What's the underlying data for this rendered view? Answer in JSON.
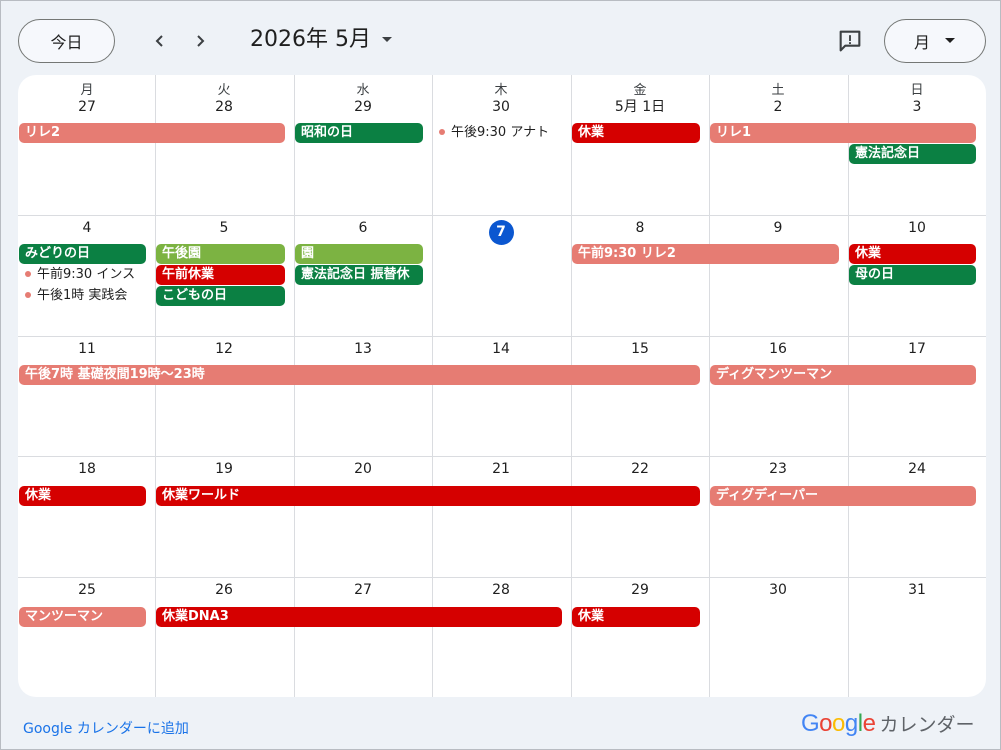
{
  "header": {
    "today_label": "今日",
    "month_title": "2026年 5月",
    "view_label": "月"
  },
  "colors": {
    "salmon": "#e67c73",
    "red": "#d50000",
    "green": "#0b8043",
    "lime": "#7cb342",
    "today": "#0b57d0"
  },
  "weekdays": [
    "月",
    "火",
    "水",
    "木",
    "金",
    "土",
    "日"
  ],
  "weeks": [
    {
      "days": [
        "27",
        "28",
        "29",
        "30",
        "5月 1日",
        "2",
        "3"
      ],
      "events": [
        {
          "title": "リレ2",
          "start": 0,
          "span": 2,
          "lane": 0,
          "color": "salmon"
        },
        {
          "title": "昭和の日",
          "start": 2,
          "span": 1,
          "lane": 0,
          "color": "green"
        },
        {
          "title": "午後9:30 アナト",
          "start": 3,
          "span": 1,
          "lane": 0,
          "type": "timed"
        },
        {
          "title": "休業",
          "start": 4,
          "span": 1,
          "lane": 0,
          "color": "red"
        },
        {
          "title": "リレ1",
          "start": 5,
          "span": 2,
          "lane": 0,
          "color": "salmon"
        },
        {
          "title": "憲法記念日",
          "start": 6,
          "span": 1,
          "lane": 1,
          "color": "green"
        }
      ]
    },
    {
      "days": [
        "4",
        "5",
        "6",
        "7",
        "8",
        "9",
        "10"
      ],
      "today_index": 3,
      "events": [
        {
          "title": "みどりの日",
          "start": 0,
          "span": 1,
          "lane": 0,
          "color": "green"
        },
        {
          "title": "午前9:30 インス",
          "start": 0,
          "span": 1,
          "lane": 1,
          "type": "timed"
        },
        {
          "title": "午後1時 実践会",
          "start": 0,
          "span": 1,
          "lane": 2,
          "type": "timed"
        },
        {
          "title": "午後園",
          "start": 1,
          "span": 1,
          "lane": 0,
          "color": "lime"
        },
        {
          "title": "午前休業",
          "start": 1,
          "span": 1,
          "lane": 1,
          "color": "red"
        },
        {
          "title": "こどもの日",
          "start": 1,
          "span": 1,
          "lane": 2,
          "color": "green"
        },
        {
          "title": "園",
          "start": 2,
          "span": 1,
          "lane": 0,
          "color": "lime"
        },
        {
          "title": "憲法記念日 振替休",
          "start": 2,
          "span": 1,
          "lane": 1,
          "color": "green"
        },
        {
          "title": "午前9:30 リレ2",
          "start": 4,
          "span": 2,
          "lane": 0,
          "color": "salmon"
        },
        {
          "title": "休業",
          "start": 6,
          "span": 1,
          "lane": 0,
          "color": "red"
        },
        {
          "title": "母の日",
          "start": 6,
          "span": 1,
          "lane": 1,
          "color": "green"
        }
      ]
    },
    {
      "days": [
        "11",
        "12",
        "13",
        "14",
        "15",
        "16",
        "17"
      ],
      "events": [
        {
          "title": "午後7時 基礎夜間19時〜23時",
          "start": 0,
          "span": 5,
          "lane": 0,
          "color": "salmon"
        },
        {
          "title": "ディグマンツーマン",
          "start": 5,
          "span": 2,
          "lane": 0,
          "color": "salmon"
        }
      ]
    },
    {
      "days": [
        "18",
        "19",
        "20",
        "21",
        "22",
        "23",
        "24"
      ],
      "events": [
        {
          "title": "休業",
          "start": 0,
          "span": 1,
          "lane": 0,
          "color": "red"
        },
        {
          "title": "休業ワールド",
          "start": 1,
          "span": 4,
          "lane": 0,
          "color": "red"
        },
        {
          "title": "ディグディーパー",
          "start": 5,
          "span": 2,
          "lane": 0,
          "color": "salmon"
        }
      ]
    },
    {
      "days": [
        "25",
        "26",
        "27",
        "28",
        "29",
        "30",
        "31"
      ],
      "events": [
        {
          "title": "マンツーマン",
          "start": 0,
          "span": 1,
          "lane": 0,
          "color": "salmon"
        },
        {
          "title": "休業DNA3",
          "start": 1,
          "span": 3,
          "lane": 0,
          "color": "red"
        },
        {
          "title": "休業",
          "start": 4,
          "span": 1,
          "lane": 0,
          "color": "red"
        }
      ]
    }
  ],
  "footer": {
    "add_link": "Google カレンダーに追加",
    "logo_text": "Google",
    "brand_text": "カレンダー"
  }
}
